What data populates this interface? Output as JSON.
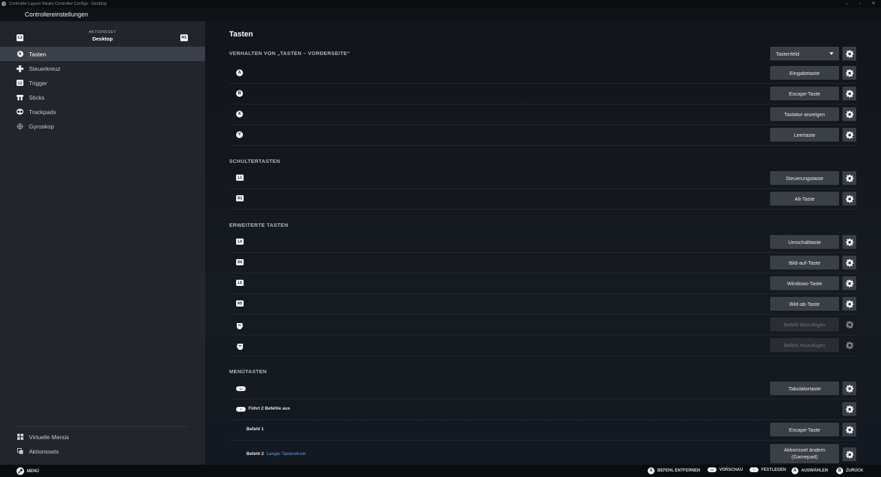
{
  "window": {
    "title": "Controller-Layout Steam Controller Configs - Desktop",
    "controls": [
      "–",
      "▫",
      "✕"
    ]
  },
  "header": {
    "title": "Controllereinstellungen"
  },
  "sidebar": {
    "actionset_label": "AKTIONSSET",
    "actionset_value": "Desktop",
    "prev_badge": "L1",
    "next_badge": "R1",
    "items": [
      {
        "label": "Tasten",
        "icon": "button-a-icon",
        "active": true
      },
      {
        "label": "Steuerkreuz",
        "icon": "dpad-icon"
      },
      {
        "label": "Trigger",
        "icon": "trigger-icon"
      },
      {
        "label": "Sticks",
        "icon": "sticks-icon"
      },
      {
        "label": "Trackpads",
        "icon": "trackpads-icon"
      },
      {
        "label": "Gyroskop",
        "icon": "gyro-icon"
      }
    ],
    "bottom_items": [
      {
        "label": "Virtuelle Menüs",
        "icon": "grid-icon"
      },
      {
        "label": "Aktionssets",
        "icon": "layers-icon"
      }
    ]
  },
  "main": {
    "title": "Tasten",
    "behavior_label": "VERHALTEN VON „TASTEN – VORDERSEITE“",
    "behavior_value": "Tastenfeld",
    "sections": [
      {
        "title": "SCHULTERTASTEN"
      },
      {
        "title": "ERWEITERTE TASTEN"
      },
      {
        "title": "MENÜTASTEN"
      }
    ],
    "face": [
      {
        "glyph": "A",
        "command": "Eingabetaste"
      },
      {
        "glyph": "B",
        "command": "Escape-Taste"
      },
      {
        "glyph": "X",
        "command": "Tastatur anzeigen"
      },
      {
        "glyph": "Y",
        "command": "Leertaste"
      }
    ],
    "shoulder": [
      {
        "glyph": "L1",
        "command": "Steuerungstaste"
      },
      {
        "glyph": "R1",
        "command": "Alt-Taste"
      }
    ],
    "extended": [
      {
        "glyph": "L4",
        "command": "Umschalttaste"
      },
      {
        "glyph": "R4",
        "command": "Bild-auf-Taste"
      },
      {
        "glyph": "L5",
        "command": "Windows-Taste"
      },
      {
        "glyph": "R5",
        "command": "Bild-ab-Taste"
      },
      {
        "glyph": "",
        "command": "Befehl hinzufügen"
      },
      {
        "glyph": "",
        "command": "Befehl hinzufügen"
      }
    ],
    "menu": {
      "view_command": "Tabulatortaste",
      "menu_text": "Führt 2 Befehle aus",
      "cmd1_label": "Befehl 1",
      "cmd1_value": "Escape-Taste",
      "cmd2_label": "Befehl 2",
      "cmd2_hint": "Langer Tastendruck",
      "cmd2_value_line1": "Aktionsset ändern",
      "cmd2_value_line2": "(Gamepad)"
    }
  },
  "footer": {
    "menu": "MENÜ",
    "remove": "BEFEHL ENTFERNEN",
    "preview": "VORSCHAU",
    "set": "FESTLEGEN",
    "select": "AUSWÄHLEN",
    "back": "ZURÜCK",
    "glyph_x": "X",
    "glyph_a": "A",
    "glyph_b": "B"
  },
  "colors": {
    "accent_hint": "#5ea3ea",
    "active_nav": "#3c4149",
    "button_bg": "#3b3f46"
  }
}
